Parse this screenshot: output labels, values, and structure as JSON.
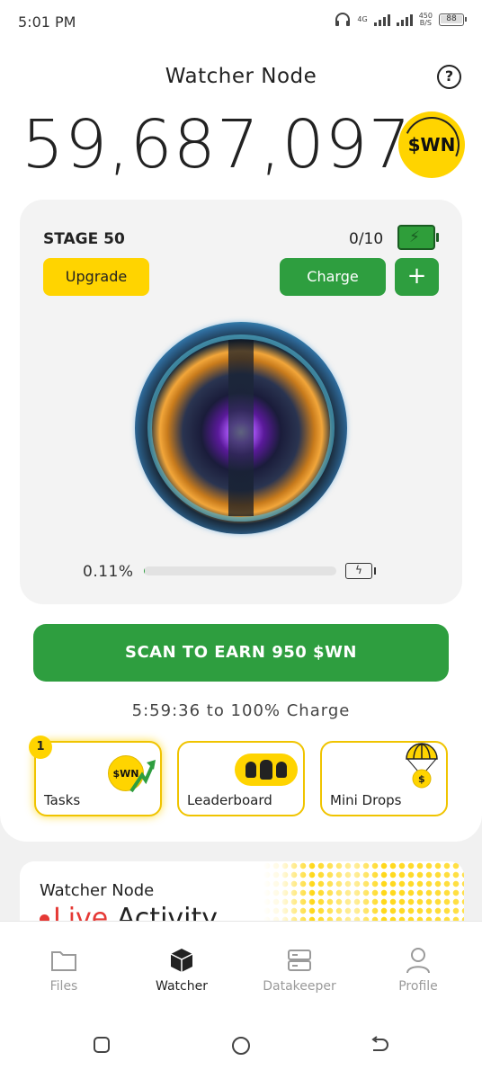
{
  "status_bar": {
    "time": "5:01 PM",
    "network_label": "4G",
    "speed_value": "450",
    "speed_unit": "B/S",
    "battery": "88"
  },
  "header": {
    "title": "Watcher Node",
    "help_icon": "question-circle-icon",
    "balance": "59,687,097",
    "coin_label": "$WN"
  },
  "stage": {
    "label": "STAGE 50",
    "charge_count": "0/10",
    "upgrade_label": "Upgrade",
    "charge_label": "Charge",
    "plus_label": "+",
    "progress_text": "0.11%",
    "progress_value": 0.0011
  },
  "scan": {
    "button_label": "SCAN TO EARN 950 $WN",
    "timer_text": "5:59:36  to 100% Charge"
  },
  "features": [
    {
      "label": "Tasks",
      "badge": "1",
      "coin": "$WN"
    },
    {
      "label": "Leaderboard"
    },
    {
      "label": "Mini Drops",
      "coin": "$"
    }
  ],
  "activity": {
    "title": "Watcher Node",
    "live_word": "Live",
    "activity_word": "Activity"
  },
  "nav": [
    {
      "label": "Files",
      "icon": "folder-icon",
      "active": false
    },
    {
      "label": "Watcher",
      "icon": "cube-icon",
      "active": true
    },
    {
      "label": "Datakeeper",
      "icon": "server-icon",
      "active": false
    },
    {
      "label": "Profile",
      "icon": "user-icon",
      "active": false
    }
  ],
  "colors": {
    "accent_green": "#2e9e3f",
    "accent_yellow": "#ffd400",
    "live_red": "#e53935"
  }
}
